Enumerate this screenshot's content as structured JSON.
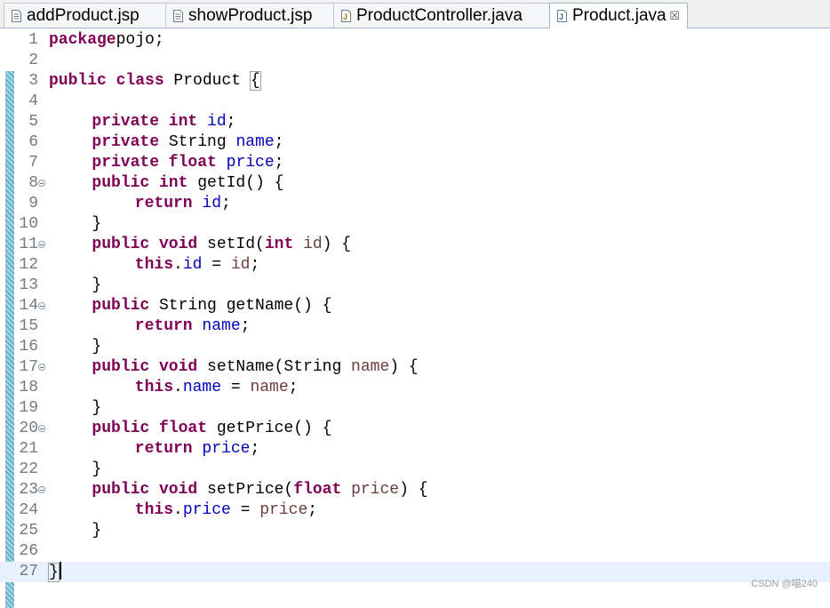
{
  "tabs": [
    {
      "label": "addProduct.jsp",
      "icon": "jsp-file-icon"
    },
    {
      "label": "showProduct.jsp",
      "icon": "jsp-file-icon"
    },
    {
      "label": "ProductController.java",
      "icon": "java-file-icon"
    },
    {
      "label": "Product.java",
      "icon": "java-file-icon",
      "active": true,
      "close": "☒"
    }
  ],
  "code_lines": [
    {
      "n": "1",
      "t": [
        [
          "kw",
          "package"
        ],
        [
          "",
          "pojo;"
        ]
      ]
    },
    {
      "n": "2",
      "t": []
    },
    {
      "n": "3",
      "t": [
        [
          "kw",
          "public class"
        ],
        [
          "",
          " Product "
        ],
        [
          "bracket",
          "{"
        ]
      ]
    },
    {
      "n": "4",
      "t": []
    },
    {
      "n": "5",
      "t": [
        [
          "",
          " "
        ],
        [
          "kw",
          "private int"
        ],
        [
          "",
          " "
        ],
        [
          "fld",
          "id"
        ],
        [
          "",
          ";"
        ]
      ]
    },
    {
      "n": "6",
      "t": [
        [
          "",
          " "
        ],
        [
          "kw",
          "private"
        ],
        [
          "",
          " String "
        ],
        [
          "fld",
          "name"
        ],
        [
          "",
          ";"
        ]
      ]
    },
    {
      "n": "7",
      "t": [
        [
          "",
          " "
        ],
        [
          "kw",
          "private float"
        ],
        [
          "",
          " "
        ],
        [
          "fld",
          "price"
        ],
        [
          "",
          ";"
        ]
      ]
    },
    {
      "n": "8",
      "fold": true,
      "t": [
        [
          "",
          " "
        ],
        [
          "kw",
          "public int"
        ],
        [
          "",
          " getId() {"
        ]
      ]
    },
    {
      "n": "9",
      "t": [
        [
          "",
          " "
        ],
        [
          "kw",
          "return"
        ],
        [
          "",
          " "
        ],
        [
          "fld",
          "id"
        ],
        [
          "",
          ";"
        ]
      ]
    },
    {
      "n": "10",
      "t": [
        [
          "",
          " }"
        ]
      ]
    },
    {
      "n": "11",
      "fold": true,
      "t": [
        [
          "",
          " "
        ],
        [
          "kw",
          "public void"
        ],
        [
          "",
          " setId("
        ],
        [
          "kw",
          "int"
        ],
        [
          "",
          " "
        ],
        [
          "par",
          "id"
        ],
        [
          "",
          ") {"
        ]
      ]
    },
    {
      "n": "12",
      "t": [
        [
          "",
          " "
        ],
        [
          "kw",
          "this"
        ],
        [
          "",
          "."
        ],
        [
          "fld",
          "id"
        ],
        [
          "",
          " = "
        ],
        [
          "par",
          "id"
        ],
        [
          "",
          ";"
        ]
      ]
    },
    {
      "n": "13",
      "t": [
        [
          "",
          " }"
        ]
      ]
    },
    {
      "n": "14",
      "fold": true,
      "t": [
        [
          "",
          " "
        ],
        [
          "kw",
          "public"
        ],
        [
          "",
          " String getName() {"
        ]
      ]
    },
    {
      "n": "15",
      "t": [
        [
          "",
          " "
        ],
        [
          "kw",
          "return"
        ],
        [
          "",
          " "
        ],
        [
          "fld",
          "name"
        ],
        [
          "",
          ";"
        ]
      ]
    },
    {
      "n": "16",
      "t": [
        [
          "",
          " }"
        ]
      ]
    },
    {
      "n": "17",
      "fold": true,
      "t": [
        [
          "",
          " "
        ],
        [
          "kw",
          "public void"
        ],
        [
          "",
          " setName(String "
        ],
        [
          "par",
          "name"
        ],
        [
          "",
          ") {"
        ]
      ]
    },
    {
      "n": "18",
      "t": [
        [
          "",
          " "
        ],
        [
          "kw",
          "this"
        ],
        [
          "",
          "."
        ],
        [
          "fld",
          "name"
        ],
        [
          "",
          " = "
        ],
        [
          "par",
          "name"
        ],
        [
          "",
          ";"
        ]
      ]
    },
    {
      "n": "19",
      "t": [
        [
          "",
          " }"
        ]
      ]
    },
    {
      "n": "20",
      "fold": true,
      "t": [
        [
          "",
          " "
        ],
        [
          "kw",
          "public float"
        ],
        [
          "",
          " getPrice() {"
        ]
      ]
    },
    {
      "n": "21",
      "t": [
        [
          "",
          " "
        ],
        [
          "kw",
          "return"
        ],
        [
          "",
          " "
        ],
        [
          "fld",
          "price"
        ],
        [
          "",
          ";"
        ]
      ]
    },
    {
      "n": "22",
      "t": [
        [
          "",
          " }"
        ]
      ]
    },
    {
      "n": "23",
      "fold": true,
      "t": [
        [
          "",
          " "
        ],
        [
          "kw",
          "public void"
        ],
        [
          "",
          " setPrice("
        ],
        [
          "kw",
          "float"
        ],
        [
          "",
          " "
        ],
        [
          "par",
          "price"
        ],
        [
          "",
          ") {"
        ]
      ]
    },
    {
      "n": "24",
      "t": [
        [
          "",
          " "
        ],
        [
          "kw",
          "this"
        ],
        [
          "",
          "."
        ],
        [
          "fld",
          "price"
        ],
        [
          "",
          " = "
        ],
        [
          "par",
          "price"
        ],
        [
          "",
          ";"
        ]
      ]
    },
    {
      "n": "25",
      "t": [
        [
          "",
          " }"
        ]
      ]
    },
    {
      "n": "26",
      "t": []
    },
    {
      "n": "27",
      "current": true,
      "t": [
        [
          "bracket",
          "}"
        ]
      ]
    }
  ],
  "watermark": "CSDN @喵240",
  "colors": {
    "keyword": "#7f0055",
    "field": "#0000c0",
    "parameter": "#6a3e3e",
    "line_number": "#787878",
    "current_line": "#e8f2fe"
  }
}
